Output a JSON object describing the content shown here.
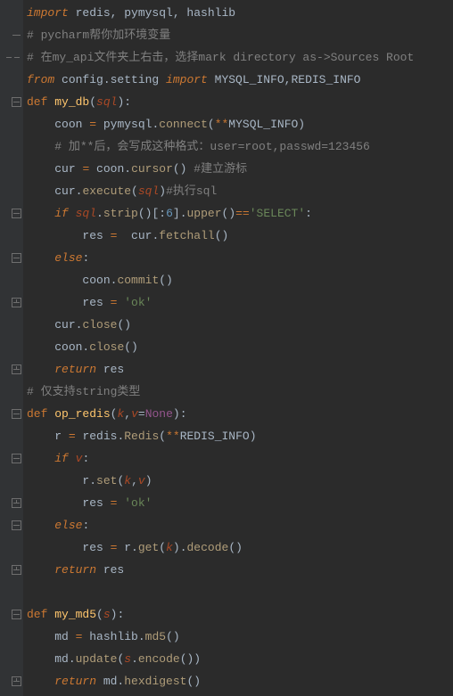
{
  "lines": [
    {
      "pre": "",
      "tokens": [
        {
          "t": "import",
          "c": "c-kw"
        },
        {
          "t": " redis, pymysql, hashlib",
          "c": ""
        }
      ]
    },
    {
      "pre": "",
      "tokens": [
        {
          "t": "# pycharm帮你加环境变量",
          "c": "c-cmt"
        }
      ]
    },
    {
      "pre": "",
      "tokens": [
        {
          "t": "# 在my_api文件夹上右击，选择mark directory as->Sources Root",
          "c": "c-cmt"
        }
      ]
    },
    {
      "pre": "",
      "tokens": [
        {
          "t": "from ",
          "c": "c-kw"
        },
        {
          "t": "config.setting ",
          "c": ""
        },
        {
          "t": "import ",
          "c": "c-kw"
        },
        {
          "t": "MYSQL_INFO,REDIS_INFO",
          "c": ""
        }
      ]
    },
    {
      "pre": "",
      "tokens": [
        {
          "t": "def ",
          "c": "c-kw2"
        },
        {
          "t": "my_db",
          "c": "c-def"
        },
        {
          "t": "(",
          "c": ""
        },
        {
          "t": "sql",
          "c": "c-param"
        },
        {
          "t": "):",
          "c": ""
        }
      ]
    },
    {
      "pre": "    ",
      "tokens": [
        {
          "t": "coon ",
          "c": ""
        },
        {
          "t": "= ",
          "c": "c-kw2"
        },
        {
          "t": "pymysql.",
          "c": ""
        },
        {
          "t": "connect",
          "c": "c-call"
        },
        {
          "t": "(",
          "c": ""
        },
        {
          "t": "**",
          "c": "c-star"
        },
        {
          "t": "MYSQL_INFO)",
          "c": ""
        }
      ]
    },
    {
      "pre": "    ",
      "tokens": [
        {
          "t": "# 加**后，会写成这种格式：user=root,passwd=123456",
          "c": "c-cmt"
        }
      ]
    },
    {
      "pre": "    ",
      "tokens": [
        {
          "t": "cur ",
          "c": ""
        },
        {
          "t": "= ",
          "c": "c-kw2"
        },
        {
          "t": "coon.",
          "c": ""
        },
        {
          "t": "cursor",
          "c": "c-call"
        },
        {
          "t": "() ",
          "c": ""
        },
        {
          "t": "#建立游标",
          "c": "c-cmt"
        }
      ]
    },
    {
      "pre": "    ",
      "tokens": [
        {
          "t": "cur.",
          "c": ""
        },
        {
          "t": "execute",
          "c": "c-call"
        },
        {
          "t": "(",
          "c": ""
        },
        {
          "t": "sql",
          "c": "c-param"
        },
        {
          "t": ")",
          "c": ""
        },
        {
          "t": "#执行sql",
          "c": "c-cmt"
        }
      ]
    },
    {
      "pre": "    ",
      "tokens": [
        {
          "t": "if ",
          "c": "c-kw"
        },
        {
          "t": "sql",
          "c": "c-param"
        },
        {
          "t": ".",
          "c": ""
        },
        {
          "t": "strip",
          "c": "c-call"
        },
        {
          "t": "()[:",
          "c": ""
        },
        {
          "t": "6",
          "c": "c-num"
        },
        {
          "t": "].",
          "c": ""
        },
        {
          "t": "upper",
          "c": "c-call"
        },
        {
          "t": "()",
          "c": ""
        },
        {
          "t": "==",
          "c": "c-kw2"
        },
        {
          "t": "'SELECT'",
          "c": "c-str"
        },
        {
          "t": ":",
          "c": ""
        }
      ]
    },
    {
      "pre": "        ",
      "tokens": [
        {
          "t": "res ",
          "c": ""
        },
        {
          "t": "= ",
          "c": "c-kw2"
        },
        {
          "t": " cur.",
          "c": ""
        },
        {
          "t": "fetchall",
          "c": "c-call"
        },
        {
          "t": "()",
          "c": ""
        }
      ]
    },
    {
      "pre": "    ",
      "tokens": [
        {
          "t": "else",
          "c": "c-kw"
        },
        {
          "t": ":",
          "c": ""
        }
      ]
    },
    {
      "pre": "        ",
      "tokens": [
        {
          "t": "coon.",
          "c": ""
        },
        {
          "t": "commit",
          "c": "c-call"
        },
        {
          "t": "()",
          "c": ""
        }
      ]
    },
    {
      "pre": "        ",
      "tokens": [
        {
          "t": "res ",
          "c": ""
        },
        {
          "t": "= ",
          "c": "c-kw2"
        },
        {
          "t": "'ok'",
          "c": "c-str"
        }
      ]
    },
    {
      "pre": "    ",
      "tokens": [
        {
          "t": "cur.",
          "c": ""
        },
        {
          "t": "close",
          "c": "c-call"
        },
        {
          "t": "()",
          "c": ""
        }
      ]
    },
    {
      "pre": "    ",
      "tokens": [
        {
          "t": "coon.",
          "c": ""
        },
        {
          "t": "close",
          "c": "c-call"
        },
        {
          "t": "()",
          "c": ""
        }
      ]
    },
    {
      "pre": "    ",
      "tokens": [
        {
          "t": "return ",
          "c": "c-kw"
        },
        {
          "t": "res",
          "c": ""
        }
      ]
    },
    {
      "pre": "",
      "tokens": [
        {
          "t": "# 仅支持string类型",
          "c": "c-cmt"
        }
      ]
    },
    {
      "pre": "",
      "tokens": [
        {
          "t": "def ",
          "c": "c-kw2"
        },
        {
          "t": "op_redis",
          "c": "c-def"
        },
        {
          "t": "(",
          "c": ""
        },
        {
          "t": "k",
          "c": "c-param"
        },
        {
          "t": ",",
          "c": ""
        },
        {
          "t": "v",
          "c": "c-param"
        },
        {
          "t": "=",
          "c": ""
        },
        {
          "t": "None",
          "c": "c-dec"
        },
        {
          "t": "):",
          "c": ""
        }
      ]
    },
    {
      "pre": "    ",
      "tokens": [
        {
          "t": "r ",
          "c": ""
        },
        {
          "t": "= ",
          "c": "c-kw2"
        },
        {
          "t": "redis.",
          "c": ""
        },
        {
          "t": "Redis",
          "c": "c-call"
        },
        {
          "t": "(",
          "c": ""
        },
        {
          "t": "**",
          "c": "c-star"
        },
        {
          "t": "REDIS_INFO)",
          "c": ""
        }
      ]
    },
    {
      "pre": "    ",
      "tokens": [
        {
          "t": "if ",
          "c": "c-kw"
        },
        {
          "t": "v",
          "c": "c-param"
        },
        {
          "t": ":",
          "c": ""
        }
      ]
    },
    {
      "pre": "        ",
      "tokens": [
        {
          "t": "r.",
          "c": ""
        },
        {
          "t": "set",
          "c": "c-call"
        },
        {
          "t": "(",
          "c": ""
        },
        {
          "t": "k",
          "c": "c-param"
        },
        {
          "t": ",",
          "c": ""
        },
        {
          "t": "v",
          "c": "c-param"
        },
        {
          "t": ")",
          "c": ""
        }
      ]
    },
    {
      "pre": "        ",
      "tokens": [
        {
          "t": "res ",
          "c": ""
        },
        {
          "t": "= ",
          "c": "c-kw2"
        },
        {
          "t": "'ok'",
          "c": "c-str"
        }
      ]
    },
    {
      "pre": "    ",
      "tokens": [
        {
          "t": "else",
          "c": "c-kw"
        },
        {
          "t": ":",
          "c": ""
        }
      ]
    },
    {
      "pre": "        ",
      "tokens": [
        {
          "t": "res ",
          "c": ""
        },
        {
          "t": "= ",
          "c": "c-kw2"
        },
        {
          "t": "r.",
          "c": ""
        },
        {
          "t": "get",
          "c": "c-call"
        },
        {
          "t": "(",
          "c": ""
        },
        {
          "t": "k",
          "c": "c-param"
        },
        {
          "t": ").",
          "c": ""
        },
        {
          "t": "decode",
          "c": "c-call"
        },
        {
          "t": "()",
          "c": ""
        }
      ]
    },
    {
      "pre": "    ",
      "tokens": [
        {
          "t": "return ",
          "c": "c-kw"
        },
        {
          "t": "res",
          "c": ""
        }
      ]
    },
    {
      "pre": "",
      "tokens": []
    },
    {
      "pre": "",
      "tokens": [
        {
          "t": "def ",
          "c": "c-kw2"
        },
        {
          "t": "my_md5",
          "c": "c-def"
        },
        {
          "t": "(",
          "c": ""
        },
        {
          "t": "s",
          "c": "c-param"
        },
        {
          "t": "):",
          "c": ""
        }
      ]
    },
    {
      "pre": "    ",
      "tokens": [
        {
          "t": "md ",
          "c": ""
        },
        {
          "t": "= ",
          "c": "c-kw2"
        },
        {
          "t": "hashlib.",
          "c": ""
        },
        {
          "t": "md5",
          "c": "c-call"
        },
        {
          "t": "()",
          "c": ""
        }
      ]
    },
    {
      "pre": "    ",
      "tokens": [
        {
          "t": "md.",
          "c": ""
        },
        {
          "t": "update",
          "c": "c-call"
        },
        {
          "t": "(",
          "c": ""
        },
        {
          "t": "s",
          "c": "c-param"
        },
        {
          "t": ".",
          "c": ""
        },
        {
          "t": "encode",
          "c": "c-call"
        },
        {
          "t": "())",
          "c": ""
        }
      ]
    },
    {
      "pre": "    ",
      "tokens": [
        {
          "t": "return ",
          "c": "c-kw"
        },
        {
          "t": "md.",
          "c": ""
        },
        {
          "t": "hexdigest",
          "c": "c-call"
        },
        {
          "t": "()",
          "c": ""
        }
      ]
    }
  ],
  "gutter": [
    "none",
    "dash",
    "row",
    "none",
    "minus",
    "none",
    "none",
    "none",
    "none",
    "minus",
    "none",
    "minus",
    "none",
    "up",
    "none",
    "none",
    "up",
    "none",
    "minus",
    "none",
    "minus",
    "none",
    "up",
    "minus",
    "none",
    "up",
    "none",
    "minus",
    "none",
    "none",
    "up"
  ]
}
